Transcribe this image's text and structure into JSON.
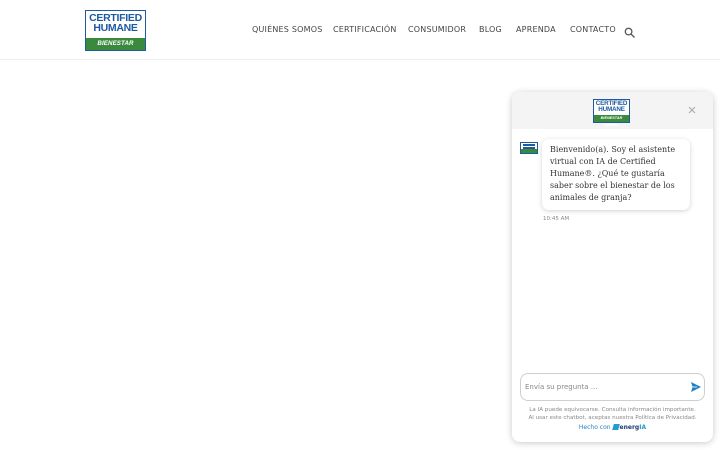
{
  "logo": {
    "line1": "CERTIFIED",
    "line2": "HUMANE",
    "line3": "BIENESTAR ANIMAL"
  },
  "nav": {
    "items": [
      {
        "label": "QUIÉNES SOMOS"
      },
      {
        "label": "CERTIFICACIÓN"
      },
      {
        "label": "CONSUMIDOR"
      },
      {
        "label": "BLOG"
      },
      {
        "label": "APRENDA"
      },
      {
        "label": "CONTACTO"
      }
    ],
    "search_icon": "search-icon"
  },
  "chat": {
    "header_logo": {
      "line1": "CERTIFIED",
      "line2": "HUMANE",
      "line3": "BIENESTAR ANIMAL"
    },
    "close_icon": "close-icon",
    "message": {
      "text": "Bienvenido(a). Soy el asistente virtual con IA de Certified Humane®. ¿Qué te gustaría saber sobre el bienestar de los animales de granja?",
      "time": "10:45 AM"
    },
    "input": {
      "placeholder": "Envía su pregunta ...",
      "value": ""
    },
    "send_icon": "send-icon",
    "disclaimer_line1": "La IA puede equivocarse. Consulta información importante.",
    "disclaimer_line2": "Al usar este chatbot, aceptas nuestra Política de Privacidad.",
    "made_with_label": "Hecho con",
    "brand_part1": "energ",
    "brand_part2": "IA"
  },
  "colors": {
    "brand_blue": "#1d5aa0",
    "brand_green": "#3a8a3e",
    "send_blue": "#1e7fc7"
  }
}
